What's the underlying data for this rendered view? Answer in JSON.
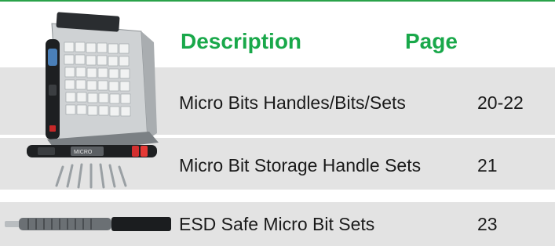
{
  "headers": {
    "description": "Description",
    "page": "Page"
  },
  "rows": [
    {
      "description": "Micro Bits Handles/Bits/Sets",
      "page": "20-22",
      "image_icon": "micro-bit-handle-case-set-icon"
    },
    {
      "description": "Micro Bit Storage Handle Sets",
      "page": "21",
      "image_icon": "storage-handle-with-bits-icon"
    },
    {
      "description": "ESD Safe Micro Bit Sets",
      "page": "23",
      "image_icon": "esd-safe-handle-icon"
    }
  ],
  "colors": {
    "accent_green": "#19a84a",
    "rule_green": "#2aa24a",
    "row_background": "#e3e3e3",
    "text": "#1a1a1a"
  }
}
